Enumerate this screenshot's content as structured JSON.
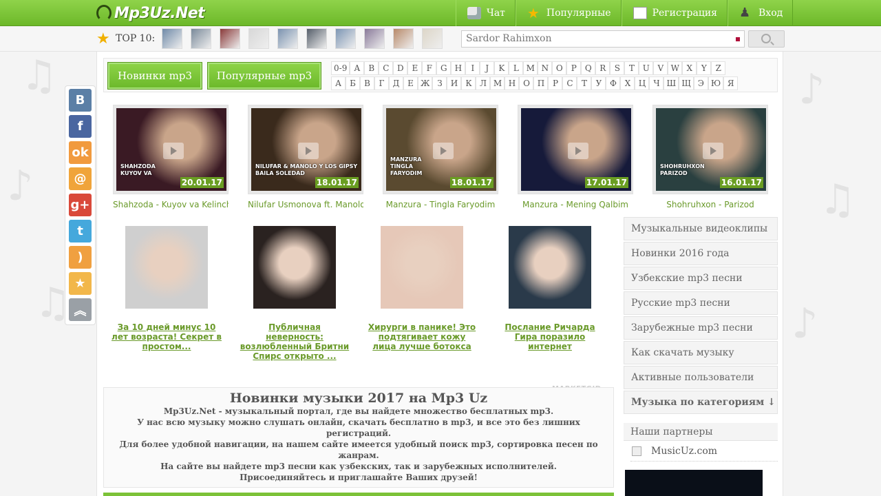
{
  "header": {
    "logo": "Mp3Uz.Net",
    "nav": [
      {
        "label": "Чат",
        "icon": "chat-icon"
      },
      {
        "label": "Популярные",
        "icon": "star-icon"
      },
      {
        "label": "Регистрация",
        "icon": "register-icon"
      },
      {
        "label": "Вход",
        "icon": "login-icon"
      }
    ]
  },
  "top10": {
    "label": "TOP 10:",
    "thumbs": [
      "#6f8aa8",
      "#7a8a9a",
      "#8a3a3a",
      "#d8d8d8",
      "#7b93b0",
      "#555e6a",
      "#7d96b4",
      "#8a7a9a",
      "#b88a6a",
      "#ddd6c8"
    ]
  },
  "search": {
    "value": "Sardor Rahimxon"
  },
  "filter": {
    "new_label": "Новинки mp3",
    "popular_label": "Популярные mp3",
    "latin": [
      "0-9",
      "A",
      "B",
      "C",
      "D",
      "E",
      "F",
      "G",
      "H",
      "I",
      "J",
      "K",
      "L",
      "M",
      "N",
      "O",
      "P",
      "Q",
      "R",
      "S",
      "T",
      "U",
      "V",
      "W",
      "X",
      "Y",
      "Z"
    ],
    "cyrillic": [
      "А",
      "Б",
      "В",
      "Г",
      "Д",
      "Е",
      "Ж",
      "З",
      "И",
      "К",
      "Л",
      "М",
      "Н",
      "О",
      "П",
      "Р",
      "С",
      "Т",
      "У",
      "Ф",
      "Х",
      "Ц",
      "Ч",
      "Ш",
      "Щ",
      "Э",
      "Ю",
      "Я"
    ]
  },
  "videos": [
    {
      "title": "Shahzoda - Kuyov va Kelinchak",
      "date": "20.01.17",
      "caption": "SHAHZODA\nKUYOV VA",
      "color": "#3a1a24"
    },
    {
      "title": "Nilufar Usmonova ft. Manolo Y",
      "date": "18.01.17",
      "caption": "NILUFAR & MANOLO Y LOS GIPSY\nBAILA SOLEDAD",
      "color": "#3a2a1c"
    },
    {
      "title": "Manzura - Tingla Faryodim",
      "date": "18.01.17",
      "caption": "MANZURA\nTINGLA\nFARYODIM",
      "color": "#5a4a30"
    },
    {
      "title": "Manzura - Mening Qalbim",
      "date": "17.01.17",
      "caption": "",
      "color": "#161a3a"
    },
    {
      "title": "Shohruhxon - Parizod",
      "date": "16.01.17",
      "caption": "SHOHRUHXON\nPARIZOD",
      "color": "#2a4040"
    }
  ],
  "ads": [
    {
      "text": "За 10 дней минус 10 лет возраста! Секрет в простом...",
      "color": "#cfcfcf"
    },
    {
      "text": "Публичная неверность: возлюбленный Бритни Спирс открыто ...",
      "color": "#2a2220"
    },
    {
      "text": "Хирурги в панике! Это подтягивает кожу лица лучше ботокса",
      "color": "#e6c8b8"
    },
    {
      "text": "Послание Ричарда Гира поразило интернет",
      "color": "#2a3a4a"
    }
  ],
  "marketgid": "MARKETGID",
  "description": {
    "title": "Новинки музыки 2017 на Mp3 Uz",
    "lines": [
      "Mp3Uz.Net - музыкальный портал, где вы найдете множество бесплатных mp3.",
      "У нас всю музыку можно слушать онлайн, скачать бесплатно в mp3, и все это без лишних регистраций.",
      "Для более удобной навигации, на нашем сайте имеется удобный поиск mp3, сортировка песен по жанрам.",
      "На сайте вы найдете mp3 песни как узбекских, так и зарубежных исполнителей.",
      "Присоединяйтесь и приглашайте Ваших друзей!"
    ]
  },
  "right_menu": [
    "Музыкальные видеоклипы",
    "Новинки 2016 года",
    "Узбекские mp3 песни",
    "Русские mp3 песни",
    "Зарубежные mp3 песни",
    "Как скачать музыку",
    "Активные пользователи",
    "Музыка по категориям ↓"
  ],
  "partners": {
    "title": "Наши партнеры",
    "link": "MusicUz.com"
  },
  "social": [
    {
      "name": "vk-icon",
      "glyph": "B",
      "color": "#5b7fa6"
    },
    {
      "name": "facebook-icon",
      "glyph": "f",
      "color": "#4a66a0"
    },
    {
      "name": "odnoklassniki-icon",
      "glyph": "ok",
      "color": "#f19a3e"
    },
    {
      "name": "mail-icon",
      "glyph": "@",
      "color": "#f0a43a"
    },
    {
      "name": "google-plus-icon",
      "glyph": "g+",
      "color": "#d9493a"
    },
    {
      "name": "twitter-icon",
      "glyph": "t",
      "color": "#45a8dc"
    },
    {
      "name": "rss-icon",
      "glyph": ")",
      "color": "#f0a040"
    },
    {
      "name": "favorite-icon",
      "glyph": "★",
      "color": "#f2b74a"
    },
    {
      "name": "scroll-up-icon",
      "glyph": "︽",
      "color": "#9aa0a6"
    }
  ]
}
